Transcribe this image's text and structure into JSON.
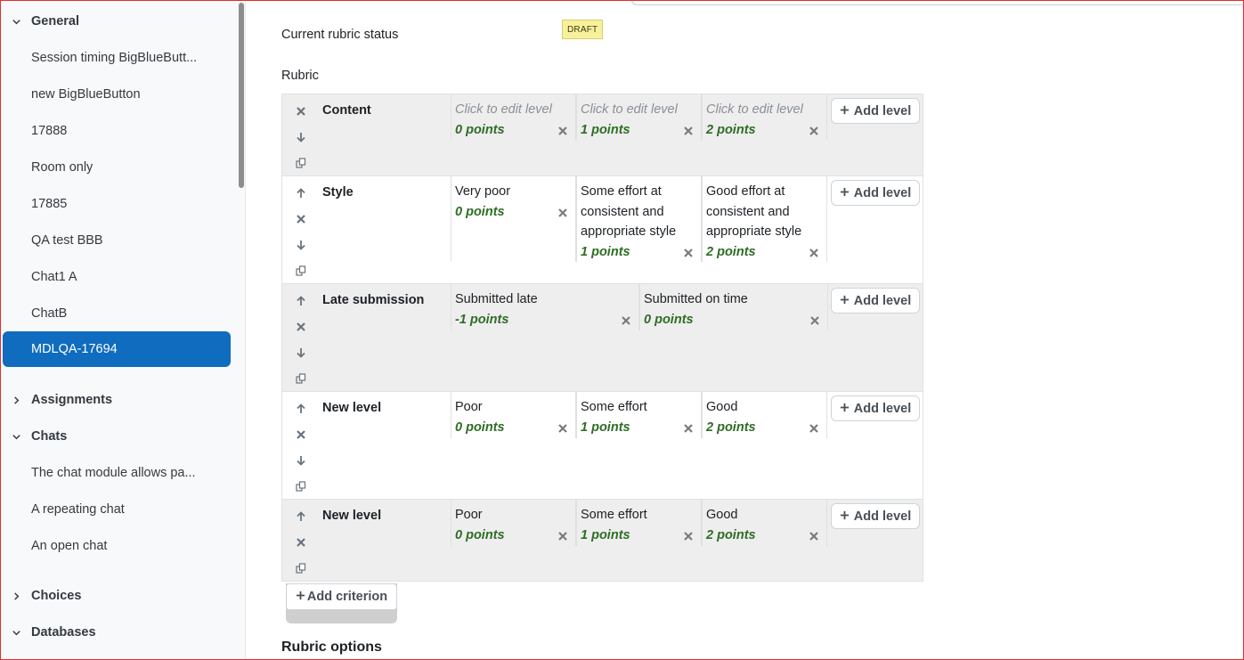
{
  "sidebar": {
    "sections": [
      {
        "label": "General",
        "expanded": true
      },
      {
        "label": "Assignments",
        "expanded": false
      },
      {
        "label": "Chats",
        "expanded": true
      },
      {
        "label": "Choices",
        "expanded": false
      },
      {
        "label": "Databases",
        "expanded": true
      }
    ],
    "general_items": [
      "Session timing BigBlueButt...",
      "new BigBlueButton",
      "17888",
      "Room only",
      "17885",
      "QA test BBB",
      "Chat1 A",
      "ChatB",
      "MDLQA-17694"
    ],
    "active_item": "MDLQA-17694",
    "chat_items": [
      "The chat module allows pa...",
      "A repeating chat",
      "An open chat"
    ]
  },
  "main": {
    "status_label": "Current rubric status",
    "status_badge": "DRAFT",
    "rubric_label": "Rubric",
    "add_level_label": "Add level",
    "add_criterion_label": "Add criterion",
    "rubric_options_heading": "Rubric options",
    "criteria": [
      {
        "name": "Content",
        "levels": [
          {
            "definition": "Click to edit level",
            "placeholder": true,
            "points": "0 points"
          },
          {
            "definition": "Click to edit level",
            "placeholder": true,
            "points": "1 points"
          },
          {
            "definition": "Click to edit level",
            "placeholder": true,
            "points": "2 points"
          }
        ]
      },
      {
        "name": "Style",
        "levels": [
          {
            "definition": "Very poor",
            "points": "0 points"
          },
          {
            "definition": "Some effort at consistent and appropriate style",
            "points": "1 points"
          },
          {
            "definition": "Good effort at consistent and appropriate style",
            "points": "2 points"
          }
        ]
      },
      {
        "name": "Late submission",
        "levels": [
          {
            "definition": "Submitted late",
            "points": "-1 points"
          },
          {
            "definition": "Submitted on time",
            "points": "0 points"
          }
        ]
      },
      {
        "name": "New level",
        "levels": [
          {
            "definition": "Poor",
            "points": "0 points"
          },
          {
            "definition": "Some effort",
            "points": "1 points"
          },
          {
            "definition": "Good",
            "points": "2 points"
          }
        ]
      },
      {
        "name": "New level",
        "levels": [
          {
            "definition": "Poor",
            "points": "0 points"
          },
          {
            "definition": "Some effort",
            "points": "1 points"
          },
          {
            "definition": "Good",
            "points": "2 points"
          }
        ]
      }
    ]
  },
  "colors": {
    "active_item_bg": "#0f6cbf",
    "points_text": "#2f6d25",
    "draft_badge_bg": "#f8f19b"
  }
}
